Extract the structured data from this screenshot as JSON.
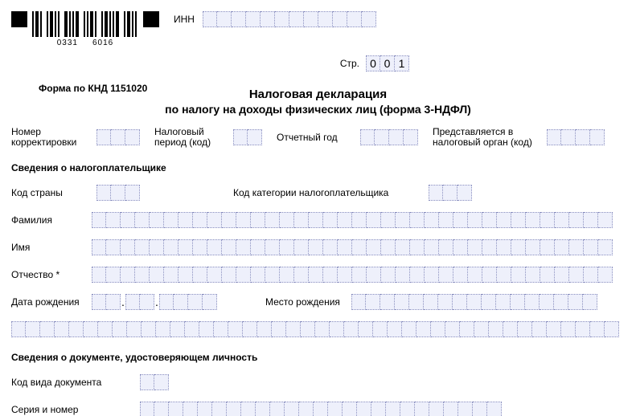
{
  "barcode_label_left": "0331",
  "barcode_label_right": "6016",
  "labels": {
    "inn": "ИНН",
    "page": "Стр.",
    "form_code": "Форма по КНД 1151020",
    "title1": "Налоговая декларация",
    "title2": "по налогу на доходы физических лиц (форма 3-НДФЛ)",
    "correction_number": "Номер корректировки",
    "tax_period": "Налоговый период (код)",
    "report_year": "Отчетный год",
    "submitted_to": "Представляется в налоговый орган (код)",
    "section_taxpayer": "Сведения о налогоплательщике",
    "country_code": "Код страны",
    "taxpayer_category": "Код категории налогоплательщика",
    "surname": "Фамилия",
    "name": "Имя",
    "patronymic": "Отчество *",
    "dob": "Дата рождения",
    "pob": "Место рождения",
    "section_document": "Сведения о документе, удостоверяющем личность",
    "doc_type_code": "Код вида документа",
    "doc_series_number": "Серия и номер"
  },
  "values": {
    "page_number": [
      "0",
      "0",
      "1"
    ],
    "inn": [
      "",
      "",
      "",
      "",
      "",
      "",
      "",
      "",
      "",
      "",
      "",
      ""
    ],
    "correction_number": [
      "",
      "",
      ""
    ],
    "tax_period": [
      "",
      ""
    ],
    "report_year": [
      "",
      "",
      "",
      ""
    ],
    "submitted_to": [
      "",
      "",
      "",
      ""
    ],
    "country_code": [
      "",
      "",
      ""
    ],
    "taxpayer_category": [
      "",
      "",
      ""
    ],
    "dob_day": [
      "",
      ""
    ],
    "dob_month": [
      "",
      ""
    ],
    "dob_year": [
      "",
      "",
      "",
      ""
    ],
    "doc_type_code": [
      "",
      ""
    ]
  }
}
